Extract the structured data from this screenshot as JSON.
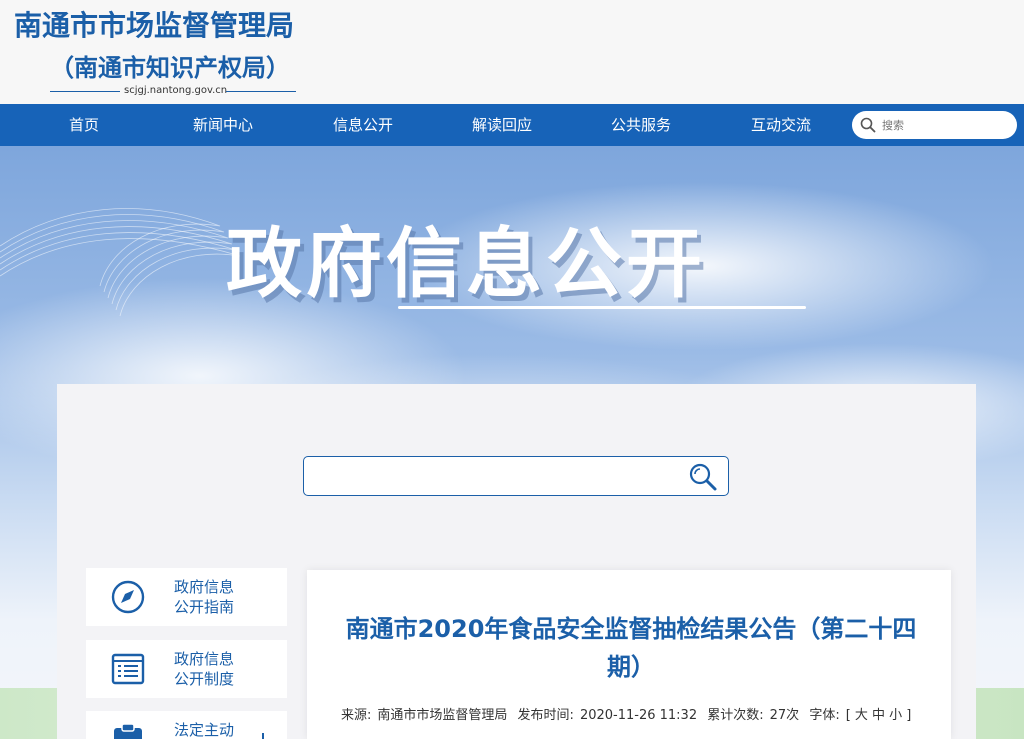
{
  "header": {
    "title": "南通市市场监督管理局",
    "subtitle": "（南通市知识产权局）",
    "domain": "scjgj.nantong.gov.cn"
  },
  "nav": {
    "items": [
      "首页",
      "新闻中心",
      "信息公开",
      "解读回应",
      "公共服务",
      "互动交流"
    ],
    "search_placeholder": "搜索"
  },
  "banner": {
    "title": "政府信息公开"
  },
  "search": {
    "value": ""
  },
  "sidebar": {
    "items": [
      {
        "line1": "政府信息",
        "line2": "公开指南",
        "icon": "compass-icon"
      },
      {
        "line1": "政府信息",
        "line2": "公开制度",
        "icon": "list-doc-icon"
      },
      {
        "line1": "法定主动",
        "line2": "",
        "icon": "clipboard-icon"
      }
    ]
  },
  "article": {
    "title": "南通市2020年食品安全监督抽检结果公告（第二十四期）",
    "source_label": "来源:",
    "source": "南通市市场监督管理局",
    "date_label": "发布时间:",
    "date": "2020-11-26 11:32",
    "views_label": "累计次数:",
    "views": "27次",
    "font_label": "字体:",
    "font_options": "[ 大 中 小 ]"
  },
  "colors": {
    "brand": "#1b5fa8",
    "nav_bg": "#1763b8"
  }
}
